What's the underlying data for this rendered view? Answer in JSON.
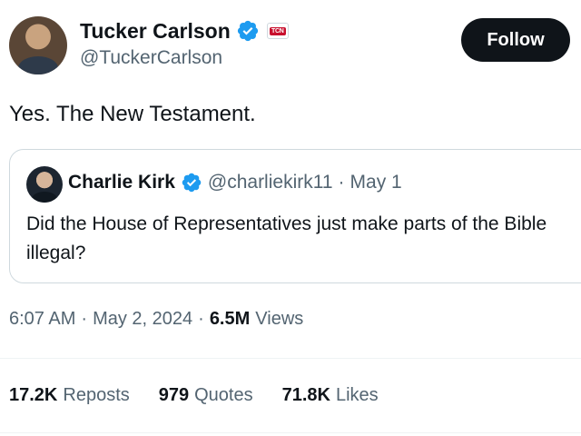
{
  "author": {
    "display_name": "Tucker Carlson",
    "handle": "@TuckerCarlson",
    "verified_icon": "verified-badge-icon",
    "affiliate_badge_text": "TCN",
    "follow_label": "Follow"
  },
  "tweet": {
    "text": "Yes. The New Testament."
  },
  "quote": {
    "display_name": "Charlie Kirk",
    "handle": "@charliekirk11",
    "separator": "·",
    "date": "May 1",
    "text": "Did the House of Representatives just make parts of the Bible illegal?"
  },
  "meta": {
    "time": "6:07 AM",
    "separator": "·",
    "date": "May 2, 2024",
    "views_count": "6.5M",
    "views_label": "Views"
  },
  "stats": [
    {
      "count": "17.2K",
      "label": "Reposts"
    },
    {
      "count": "979",
      "label": "Quotes"
    },
    {
      "count": "71.8K",
      "label": "Likes"
    }
  ],
  "colors": {
    "verified_blue": "#1d9bf0",
    "text_primary": "#0f1419",
    "text_secondary": "#536471",
    "border": "#cfd9de",
    "button_bg": "#0f1419"
  }
}
